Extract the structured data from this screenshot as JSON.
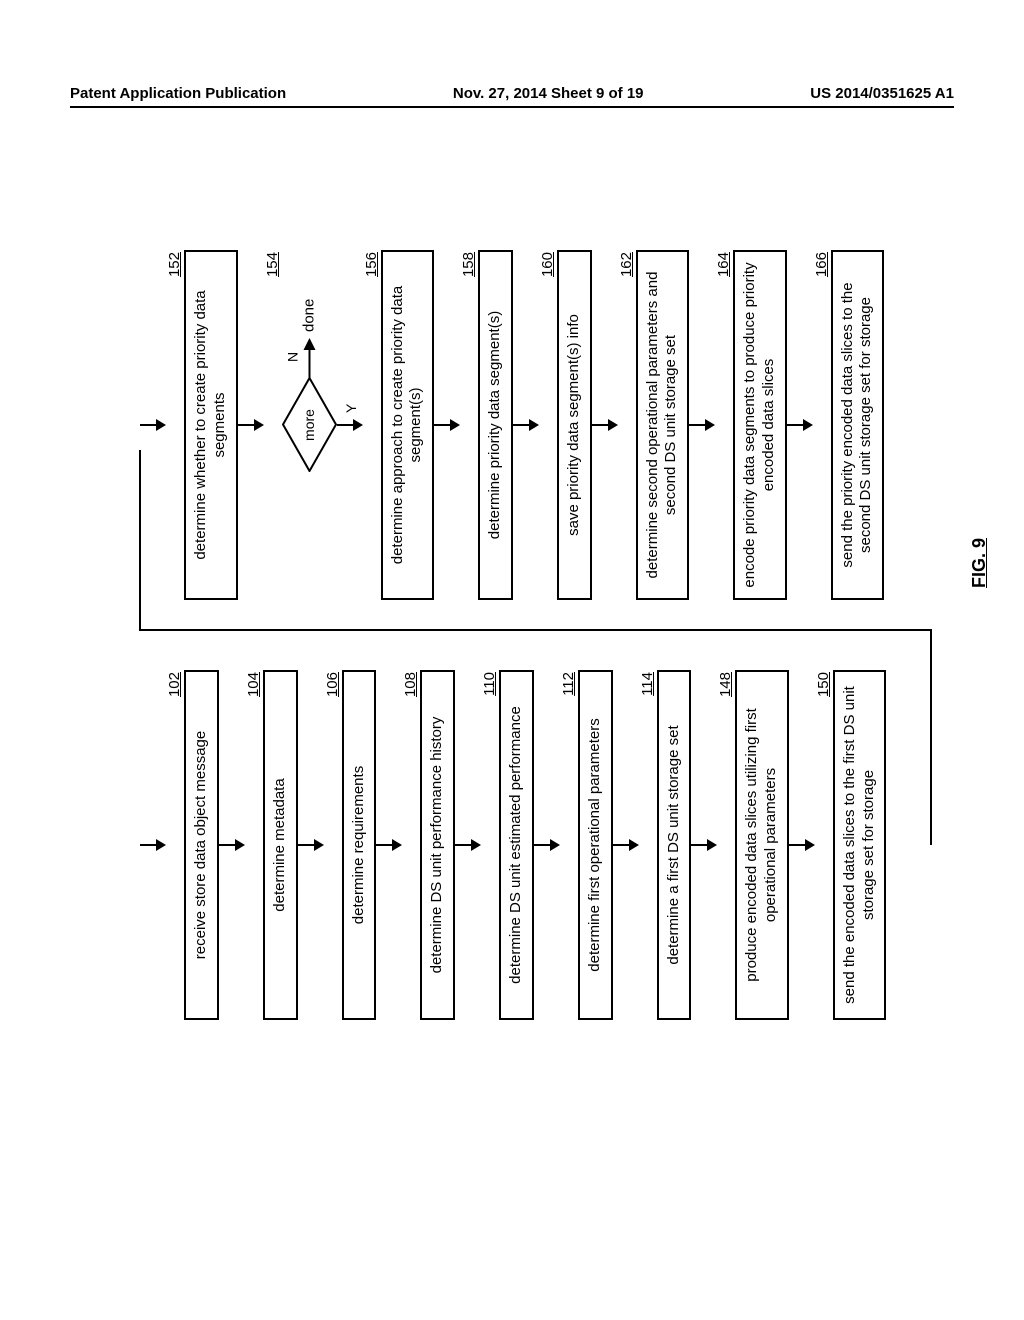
{
  "header": {
    "left": "Patent Application Publication",
    "center": "Nov. 27, 2014  Sheet 9 of 19",
    "right": "US 2014/0351625 A1"
  },
  "fig_label": "FIG. 9",
  "left_col": [
    {
      "num": "102",
      "text": "receive store data object message"
    },
    {
      "num": "104",
      "text": "determine metadata"
    },
    {
      "num": "106",
      "text": "determine requirements"
    },
    {
      "num": "108",
      "text": "determine DS unit performance history"
    },
    {
      "num": "110",
      "text": "determine DS unit estimated performance"
    },
    {
      "num": "112",
      "text": "determine first operational parameters"
    },
    {
      "num": "114",
      "text": "determine a first DS unit storage set"
    },
    {
      "num": "148",
      "text": "produce encoded data slices utilizing first operational parameters"
    },
    {
      "num": "150",
      "text": "send the encoded data slices to the first DS unit storage set for storage"
    }
  ],
  "right_col_top": {
    "num": "152",
    "text": "determine whether to create priority data segments"
  },
  "decision": {
    "num": "154",
    "label": "more",
    "yes": "Y",
    "no": "N",
    "done": "done"
  },
  "right_col_rest": [
    {
      "num": "156",
      "text": "determine approach to create priority data segment(s)"
    },
    {
      "num": "158",
      "text": "determine priority data segment(s)"
    },
    {
      "num": "160",
      "text": "save priority data segment(s) info"
    },
    {
      "num": "162",
      "text": "determine second operational parameters and second DS unit storage set"
    },
    {
      "num": "164",
      "text": "encode priority data segments to produce priority encoded data slices"
    },
    {
      "num": "166",
      "text": "send the priority encoded data slices to the second DS unit storage set for storage"
    }
  ]
}
